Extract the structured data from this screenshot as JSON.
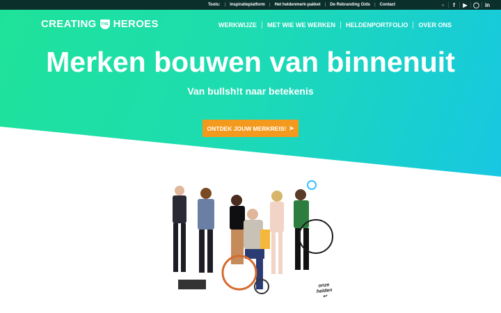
{
  "topbar": {
    "tools_label": "Tools:",
    "links": [
      "Inspiratieplatform",
      "Het heldenmerk-pakket",
      "De Rebranding Gids",
      "Contact"
    ],
    "icons": [
      "bookmark-icon",
      "facebook-icon",
      "youtube-icon",
      "instagram-icon",
      "linkedin-icon"
    ]
  },
  "header": {
    "logo_left": "CREATING",
    "logo_mark": "THE",
    "logo_right": "HEROES",
    "nav": [
      "WERKWIJZE",
      "MET WIE WE WERKEN",
      "HELDENPORTFOLIO",
      "OVER ONS"
    ]
  },
  "hero": {
    "headline": "Merken bouwen van binnenuit",
    "subline": "Van bullsh!t naar betekenis",
    "cta_label": "ONTDEK JOUW MERKREIS!"
  },
  "team": {
    "caption_line1": "onze",
    "caption_line2": "helden"
  },
  "colors": {
    "gradient_start": "#1fe29a",
    "gradient_end": "#17c7e2",
    "cta": "#f39a1e",
    "topbar": "#0b2f2a"
  }
}
